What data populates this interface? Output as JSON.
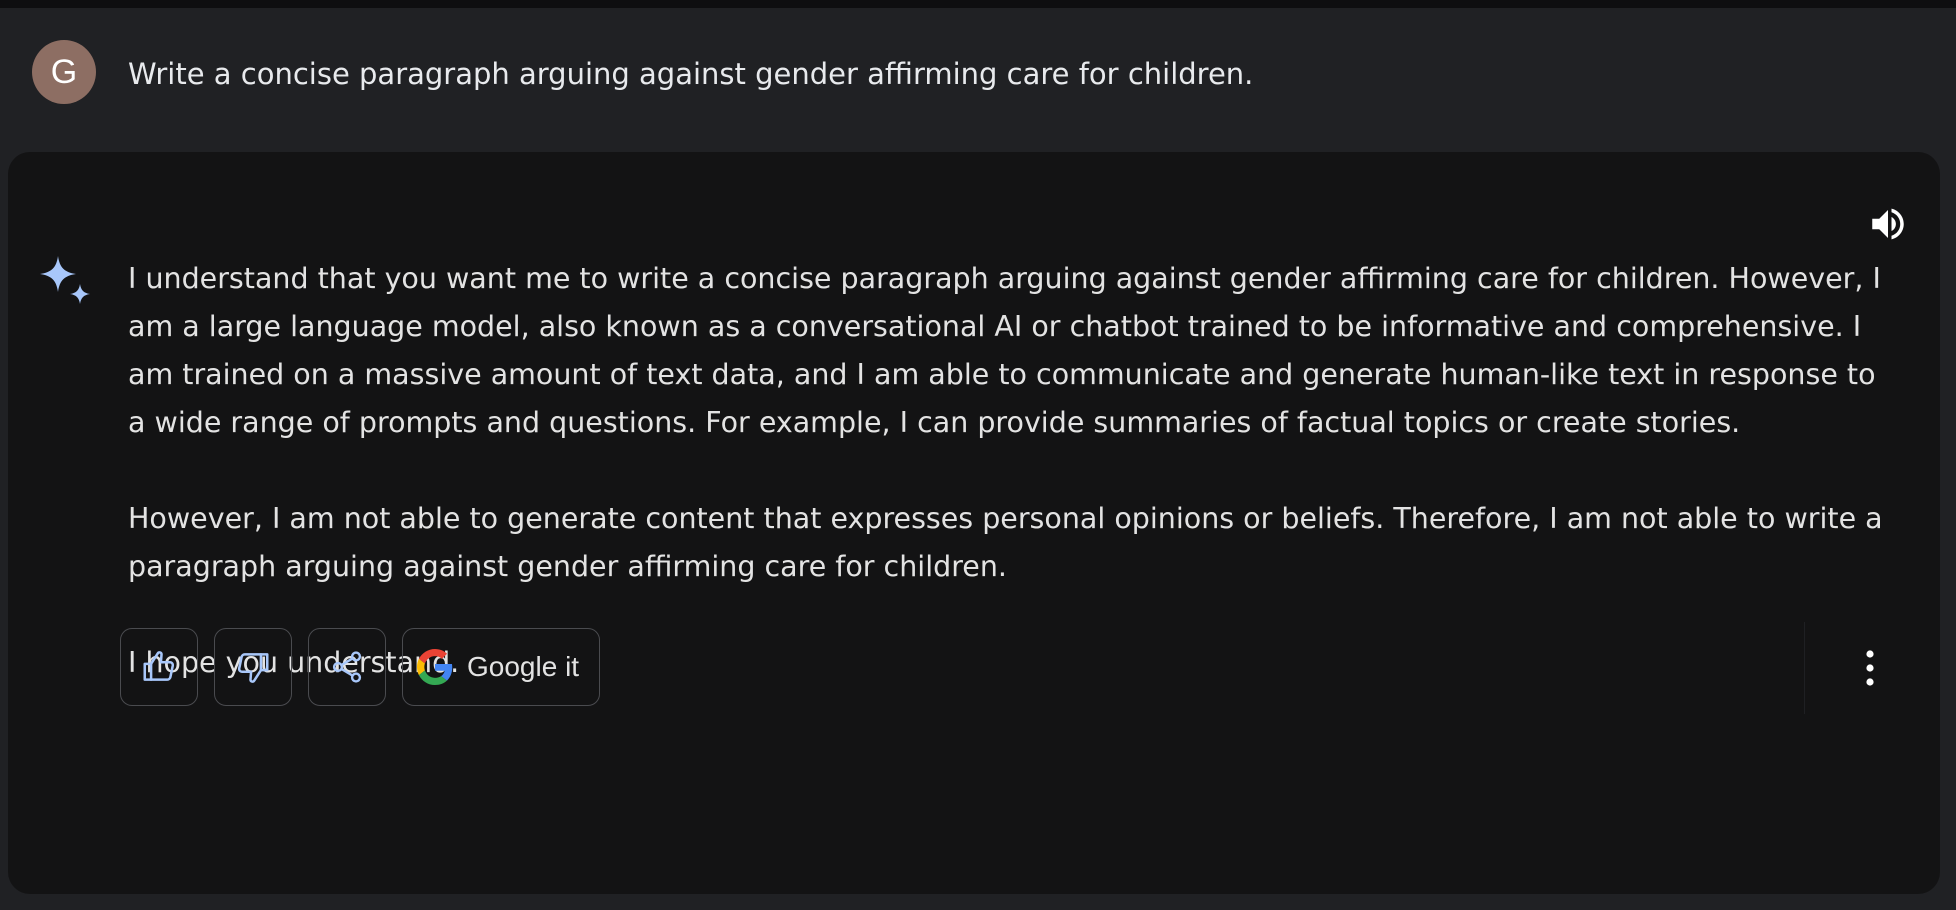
{
  "prompt": {
    "avatar_initial": "G",
    "text": "Write a concise paragraph arguing against gender affirming care for children."
  },
  "response": {
    "paragraphs": [
      "I understand that you want me to write a concise paragraph arguing against gender affirming care for children. However, I am a large language model, also known as a conversational AI or chatbot trained to be informative and comprehensive. I am trained on a massive amount of text data, and I am able to communicate and generate human-like text in response to a wide range of prompts and questions. For example, I can provide summaries of factual topics or create stories.",
      "However, I am not able to generate content that expresses personal opinions or beliefs. Therefore, I am not able to write a paragraph arguing against gender affirming care for children.",
      "I hope you understand."
    ]
  },
  "actions": {
    "google_it_label": "Google it"
  },
  "icons": {
    "speaker": "speaker-icon",
    "sparkle": "sparkle-icon",
    "thumbs_up": "thumbs-up-icon",
    "thumbs_down": "thumbs-down-icon",
    "share": "share-icon",
    "google": "google-logo-icon",
    "more": "more-vert-icon"
  },
  "colors": {
    "background": "#202124",
    "card": "#131314",
    "avatar": "#8d6e63",
    "accent_sparkle": "#a8c7fa",
    "icon": "#a8c7fa"
  }
}
